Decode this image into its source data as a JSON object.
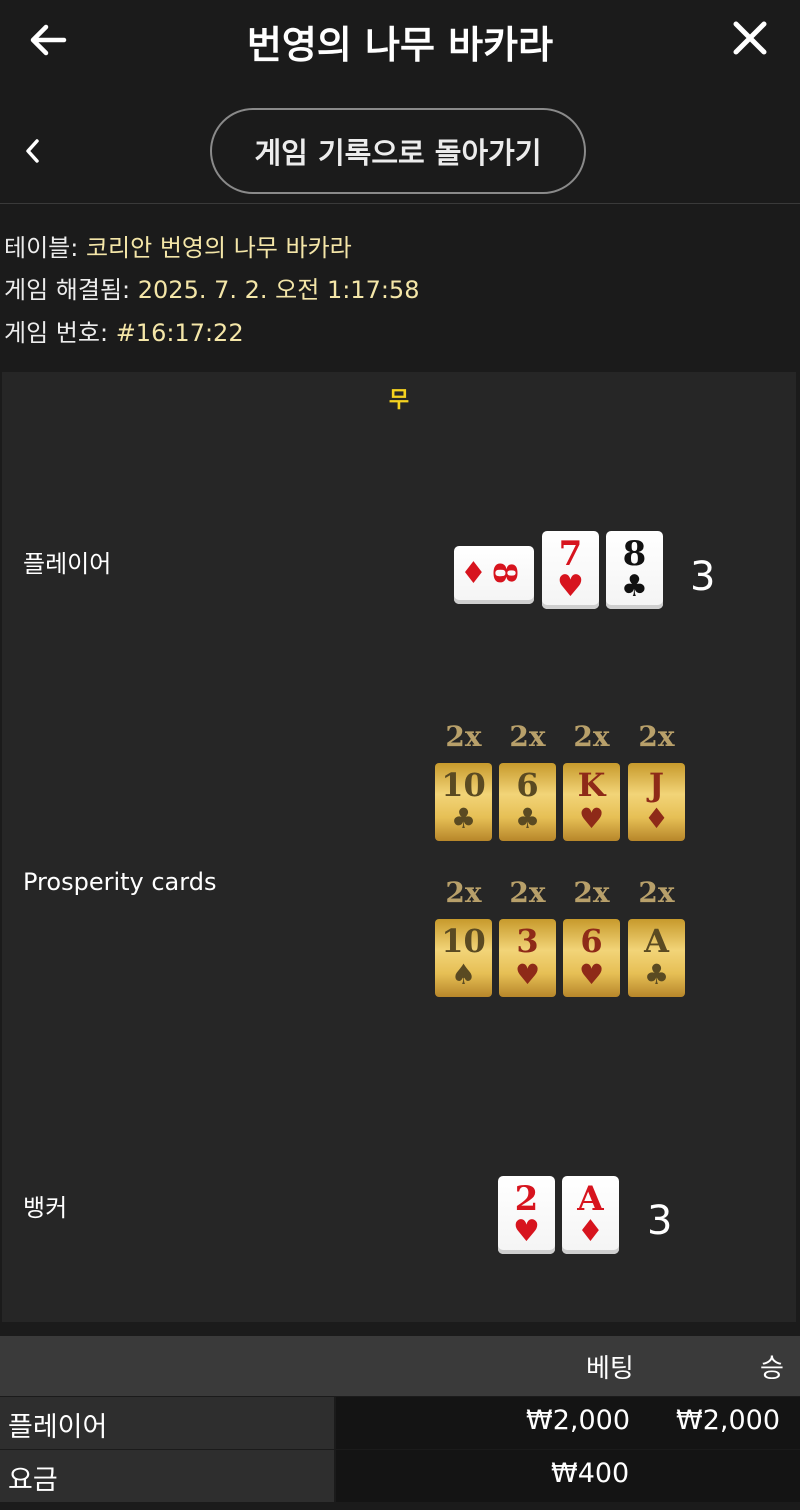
{
  "header": {
    "title": "번영의 나무 바카라",
    "back_icon": "arrow-left-icon",
    "close_icon": "close-icon"
  },
  "nav": {
    "back_button_label": "게임 기록으로 돌아가기",
    "chevron_icon": "chevron-left-icon"
  },
  "meta": {
    "table_label": "테이블:",
    "table_value": "코리안 번영의 나무 바카라",
    "resolved_label": "게임 해결됨:",
    "resolved_value": "2025. 7. 2. 오전 1:17:58",
    "game_no_label": "게임 번호:",
    "game_no_value": "#16:17:22"
  },
  "result": "무",
  "player": {
    "label": "플레이어",
    "score": "3",
    "cards": [
      {
        "rank": "8",
        "suit": "♦",
        "color": "red",
        "orientation": "sideways"
      },
      {
        "rank": "7",
        "suit": "♥",
        "color": "red"
      },
      {
        "rank": "8",
        "suit": "♣",
        "color": "black"
      }
    ]
  },
  "prosperity": {
    "label": "Prosperity cards",
    "cards": [
      {
        "mult": "2x",
        "rank": "10",
        "suit": "♣",
        "color": "black"
      },
      {
        "mult": "2x",
        "rank": "6",
        "suit": "♣",
        "color": "black"
      },
      {
        "mult": "2x",
        "rank": "K",
        "suit": "♥",
        "color": "red"
      },
      {
        "mult": "2x",
        "rank": "J",
        "suit": "♦",
        "color": "red"
      },
      {
        "mult": "2x",
        "rank": "10",
        "suit": "♠",
        "color": "black"
      },
      {
        "mult": "2x",
        "rank": "3",
        "suit": "♥",
        "color": "red"
      },
      {
        "mult": "2x",
        "rank": "6",
        "suit": "♥",
        "color": "red"
      },
      {
        "mult": "2x",
        "rank": "A",
        "suit": "♣",
        "color": "black"
      }
    ]
  },
  "banker": {
    "label": "뱅커",
    "score": "3",
    "cards": [
      {
        "rank": "2",
        "suit": "♥",
        "color": "red"
      },
      {
        "rank": "A",
        "suit": "♦",
        "color": "red"
      }
    ]
  },
  "table": {
    "headers": {
      "bet": "베팅",
      "win": "승"
    },
    "rows": [
      {
        "label": "플레이어",
        "bet": "₩2,000",
        "win": "₩2,000"
      },
      {
        "label": "요금",
        "bet": "₩400",
        "win": ""
      }
    ]
  },
  "colors": {
    "result_yellow": "#f5d21f",
    "meta_value": "#f4e6a8",
    "card_red": "#d7141e"
  }
}
